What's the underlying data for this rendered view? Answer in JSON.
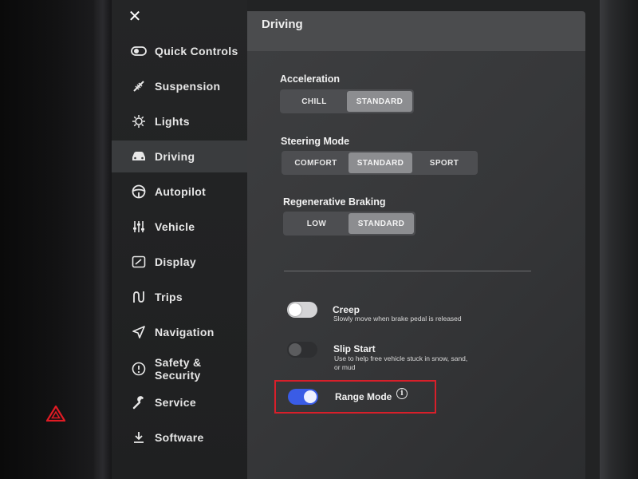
{
  "sidebar": {
    "close_icon": "close-icon",
    "items": [
      {
        "label": "Quick Controls",
        "icon": "toggle-icon",
        "active": false
      },
      {
        "label": "Suspension",
        "icon": "suspension-icon",
        "active": false
      },
      {
        "label": "Lights",
        "icon": "sun-icon",
        "active": false
      },
      {
        "label": "Driving",
        "icon": "car-icon",
        "active": true
      },
      {
        "label": "Autopilot",
        "icon": "steering-wheel-icon",
        "active": false
      },
      {
        "label": "Vehicle",
        "icon": "sliders-icon",
        "active": false
      },
      {
        "label": "Display",
        "icon": "display-icon",
        "active": false
      },
      {
        "label": "Trips",
        "icon": "trips-icon",
        "active": false
      },
      {
        "label": "Navigation",
        "icon": "navigation-icon",
        "active": false
      },
      {
        "label": "Safety & Security",
        "icon": "info-circle-icon",
        "active": false
      },
      {
        "label": "Service",
        "icon": "wrench-icon",
        "active": false
      },
      {
        "label": "Software",
        "icon": "download-icon",
        "active": false
      }
    ]
  },
  "header": {
    "title": "Driving"
  },
  "settings": {
    "acceleration": {
      "label": "Acceleration",
      "options": [
        "CHILL",
        "STANDARD"
      ],
      "selected": "STANDARD"
    },
    "steering_mode": {
      "label": "Steering Mode",
      "options": [
        "COMFORT",
        "STANDARD",
        "SPORT"
      ],
      "selected": "STANDARD"
    },
    "regen_braking": {
      "label": "Regenerative Braking",
      "options": [
        "LOW",
        "STANDARD"
      ],
      "selected": "STANDARD"
    }
  },
  "toggles": {
    "creep": {
      "title": "Creep",
      "description": "Slowly move when brake pedal is released",
      "on": false
    },
    "slip_start": {
      "title": "Slip Start",
      "description": "Use to help free vehicle stuck in snow, sand, or mud",
      "on": false
    },
    "range_mode": {
      "title": "Range Mode",
      "info_icon": "i",
      "on": true
    }
  },
  "colors": {
    "accent": "#3a5ce6",
    "highlight": "#d81f2a",
    "hazard": "#e01b24"
  }
}
